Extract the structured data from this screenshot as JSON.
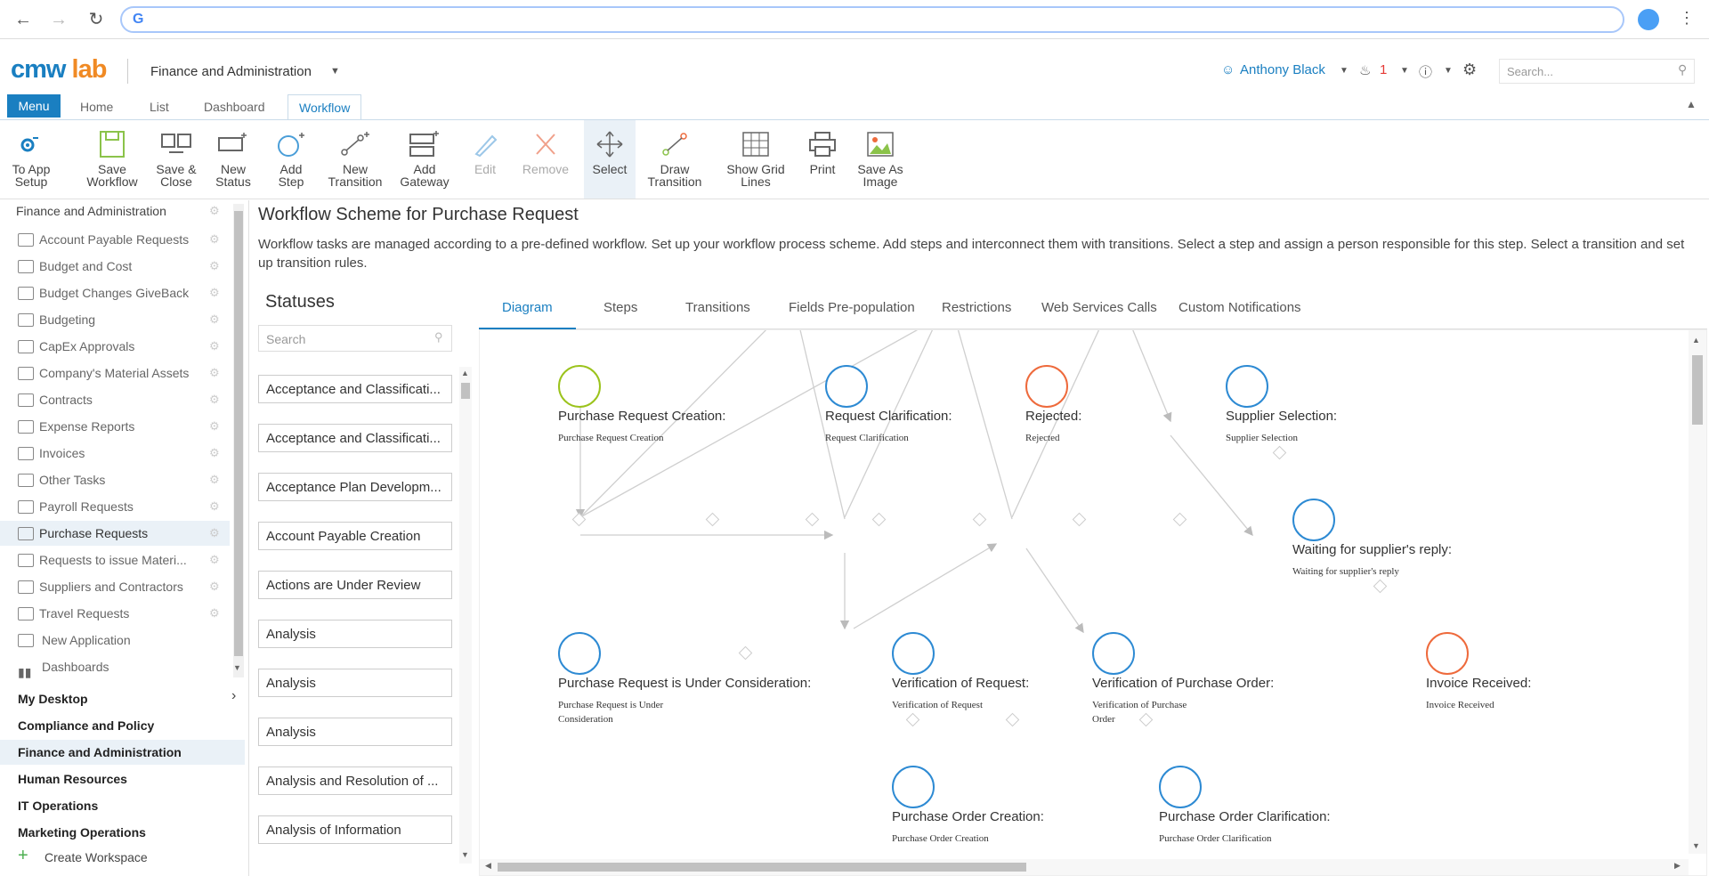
{
  "browser": {
    "address": "",
    "google_glyph": "G"
  },
  "app": {
    "logo_left": "cmw",
    "logo_right": "lab",
    "workspace": "Finance and Administration",
    "user": "Anthony Black",
    "notifications": "1",
    "search_placeholder": "Search..."
  },
  "menu": {
    "menu_label": "Menu",
    "tabs": [
      "Home",
      "List",
      "Dashboard",
      "Workflow"
    ]
  },
  "toolbar": [
    {
      "label1": "To App",
      "label2": "Setup"
    },
    {
      "label1": "Save",
      "label2": "Workflow"
    },
    {
      "label1": "Save &",
      "label2": "Close"
    },
    {
      "label1": "New",
      "label2": "Status"
    },
    {
      "label1": "Add",
      "label2": "Step"
    },
    {
      "label1": "New",
      "label2": "Transition"
    },
    {
      "label1": "Add",
      "label2": "Gateway"
    },
    {
      "label1": "Edit",
      "label2": ""
    },
    {
      "label1": "Remove",
      "label2": ""
    },
    {
      "label1": "Select",
      "label2": ""
    },
    {
      "label1": "Draw",
      "label2": "Transition"
    },
    {
      "label1": "Show Grid",
      "label2": "Lines"
    },
    {
      "label1": "Print",
      "label2": ""
    },
    {
      "label1": "Save As",
      "label2": "Image"
    }
  ],
  "sidebar": {
    "header": "Finance and Administration",
    "items": [
      "Account Payable Requests",
      "Budget and Cost",
      "Budget Changes GiveBack",
      "Budgeting",
      "CapEx Approvals",
      "Company's Material Assets",
      "Contracts",
      "Expense Reports",
      "Invoices",
      "Other Tasks",
      "Payroll Requests",
      "Purchase Requests",
      "Requests to issue Materi...",
      "Suppliers and Contractors",
      "Travel Requests"
    ],
    "new_application": "New Application",
    "dashboards": "Dashboards",
    "groups": [
      "My Desktop",
      "Compliance and Policy",
      "Finance and Administration",
      "Human Resources",
      "IT Operations",
      "Marketing Operations"
    ],
    "create_workspace": "Create Workspace"
  },
  "main": {
    "title": "Workflow Scheme for Purchase Request",
    "description": "Workflow tasks are managed according to a pre-defined workflow. Set up your workflow process scheme. Add steps and interconnect them with transitions. Select a step and assign a person responsible for this step. Select a transition and set up transition rules."
  },
  "statuses": {
    "title": "Statuses",
    "search_placeholder": "Search",
    "items": [
      "Acceptance and Classificati...",
      "Acceptance and Classificati...",
      "Acceptance Plan Developm...",
      "Account Payable Creation",
      "Actions are Under Review",
      "Analysis",
      "Analysis",
      "Analysis",
      "Analysis and Resolution of ...",
      "Analysis of Information"
    ]
  },
  "tabs": [
    "Diagram",
    "Steps",
    "Transitions",
    "Fields Pre-population",
    "Restrictions",
    "Web Services Calls",
    "Custom Notifications"
  ],
  "diagram": {
    "nodes": [
      {
        "title": "Purchase Request Creation:",
        "sub": "Purchase Request Creation",
        "color": "#9bc31c"
      },
      {
        "title": "Request Clarification:",
        "sub": "Request Clarification",
        "color": "#2d8ad3"
      },
      {
        "title": "Rejected:",
        "sub": "Rejected",
        "color": "#ee6a3c"
      },
      {
        "title": "Supplier Selection:",
        "sub": "Supplier Selection",
        "color": "#2d8ad3"
      },
      {
        "title": "Waiting for supplier's reply:",
        "sub": "Waiting for supplier's reply",
        "color": "#2d8ad3"
      },
      {
        "title": "Purchase Request is Under Consideration:",
        "sub1": "Purchase Request is Under",
        "sub2": "Consideration",
        "color": "#2d8ad3"
      },
      {
        "title": "Verification of Request:",
        "sub": "Verification of Request",
        "color": "#2d8ad3"
      },
      {
        "title": "Verification of Purchase Order:",
        "sub1": "Verification of Purchase",
        "sub2": "Order",
        "color": "#2d8ad3"
      },
      {
        "title": "Invoice Received:",
        "sub": "Invoice Received",
        "color": "#ee6a3c"
      },
      {
        "title": "Purchase Order Creation:",
        "sub": "Purchase Order Creation",
        "color": "#2d8ad3"
      },
      {
        "title": "Purchase Order Clarification:",
        "sub": "Purchase Order Clarification",
        "color": "#2d8ad3"
      }
    ]
  }
}
